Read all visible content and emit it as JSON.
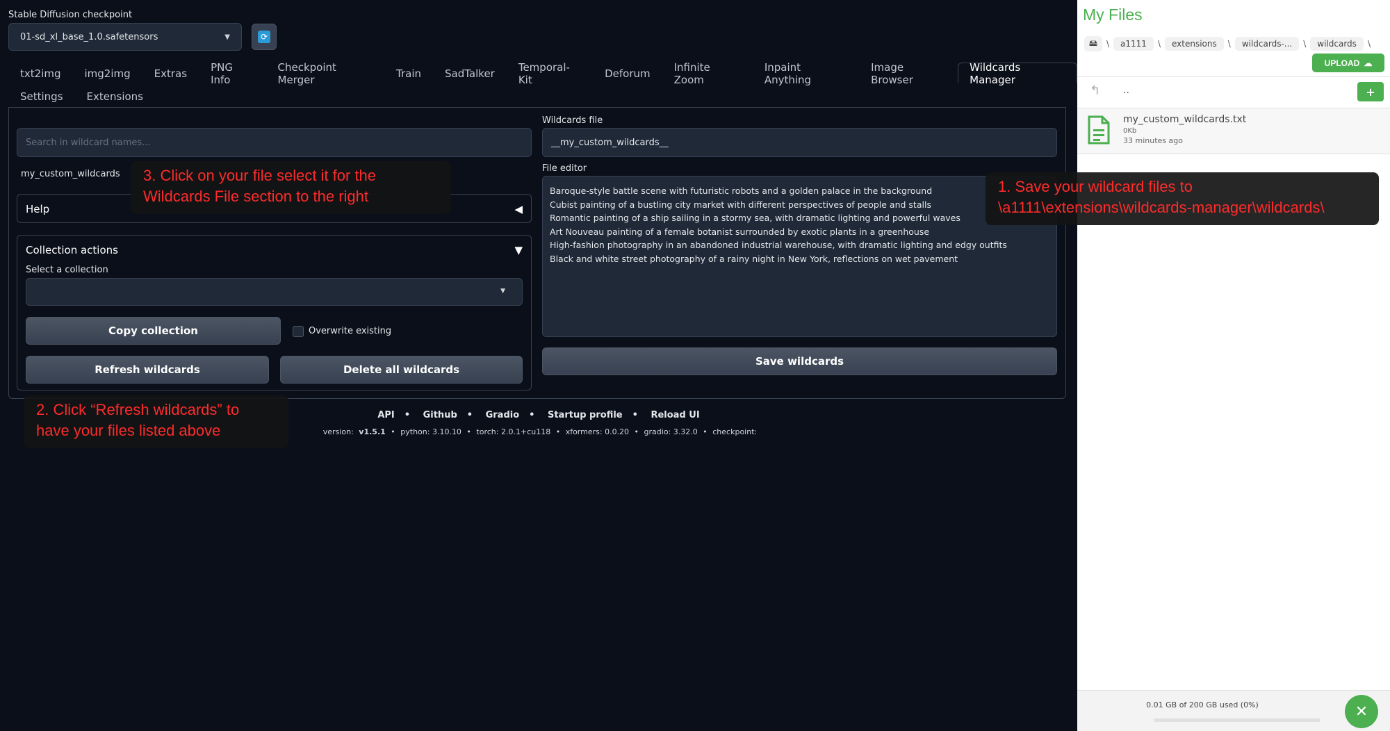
{
  "checkpoint": {
    "label": "Stable Diffusion checkpoint",
    "value": "01-sd_xl_base_1.0.safetensors",
    "refresh_icon": "refresh-icon"
  },
  "tabs_row1": [
    "txt2img",
    "img2img",
    "Extras",
    "PNG Info",
    "Checkpoint Merger",
    "Train",
    "SadTalker",
    "Temporal-Kit",
    "Deforum",
    "Infinite Zoom",
    "Inpaint Anything",
    "Image Browser",
    "Wildcards Manager"
  ],
  "tabs_row2": [
    "Settings",
    "Extensions"
  ],
  "active_tab": "Wildcards Manager",
  "left": {
    "search_placeholder": "Search in wildcard names...",
    "file_item": "my_custom_wildcards",
    "help_title": "Help",
    "collection_title": "Collection actions",
    "select_label": "Select a collection",
    "copy_label": "Copy collection",
    "overwrite_label": "Overwrite existing",
    "refresh_label": "Refresh wildcards",
    "delete_label": "Delete all wildcards"
  },
  "right": {
    "wildcards_file_label": "Wildcards file",
    "wildcards_file_value": "__my_custom_wildcards__",
    "file_editor_label": "File editor",
    "file_editor_lines": [
      "Baroque-style battle scene with futuristic robots and a golden palace in the background",
      "Cubist painting of a bustling city market with different perspectives of people and stalls",
      "Romantic painting of a ship sailing in a stormy sea, with dramatic lighting and powerful waves",
      "Art Nouveau painting of a female botanist surrounded by exotic plants in a greenhouse",
      "High-fashion photography in an abandoned industrial warehouse, with dramatic lighting and edgy outfits",
      "Black and white street photography of a rainy night in New York, reflections on wet pavement"
    ],
    "save_label": "Save wildcards"
  },
  "footer": {
    "links": [
      "API",
      "Github",
      "Gradio",
      "Startup profile",
      "Reload UI"
    ],
    "version": {
      "version_label": "version:",
      "version_value": "v1.5.1",
      "python": "python: 3.10.10",
      "torch": "torch: 2.0.1+cu118",
      "xformers": "xformers: 0.0.20",
      "gradio": "gradio: 3.32.0",
      "checkpoint": "checkpoint:"
    }
  },
  "callouts": {
    "one": "1. Save your wildcard files to \\a1111\\extensions\\wildcards-manager\\wildcards\\",
    "two": "2. Click “Refresh wildcards” to have your files listed above",
    "three": "3. Click on your file select it for the Wildcards File section to the right"
  },
  "files_panel": {
    "title": "My Files",
    "breadcrumbs": [
      "a1111",
      "extensions",
      "wildcards-...",
      "wildcards"
    ],
    "upload_label": "UPLOAD",
    "parent_dir": "..",
    "file": {
      "name": "my_custom_wildcards.txt",
      "size": "0Kb",
      "modified": "33 minutes ago"
    },
    "storage_text": "0.01 GB of 200 GB used (0%)",
    "storage_used_fraction": 0.0,
    "accent_color": "#4caf50"
  }
}
